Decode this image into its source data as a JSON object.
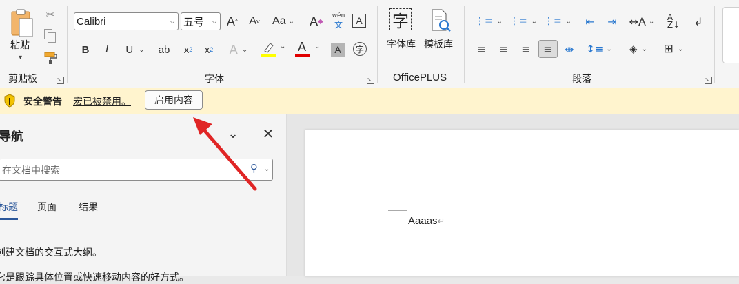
{
  "ribbon": {
    "clipboard": {
      "paste_label": "粘贴",
      "group_label": "剪贴板"
    },
    "font": {
      "font_name": "Calibri",
      "font_size": "五号",
      "group_label": "字体",
      "change_case_label": "Aa",
      "wen_top": "wén",
      "wen_bottom": "文",
      "char_border_label": "A",
      "superscript_mark": "2",
      "subscript_mark": "2",
      "highlight_color": "#ffff00",
      "font_color": "#e00000"
    },
    "officeplus": {
      "font_lib_label": "字体库",
      "template_lib_label": "模板库",
      "group_label": "OfficePLUS",
      "zi_glyph": "字"
    },
    "paragraph": {
      "group_label": "段落"
    }
  },
  "security_bar": {
    "title": "安全警告",
    "message": "宏已被禁用。",
    "button_label": "启用内容"
  },
  "nav_pane": {
    "title": "导航",
    "search_placeholder": "在文档中搜索",
    "tabs": [
      "标题",
      "页面",
      "结果"
    ],
    "active_tab": 0,
    "info_line1": "创建文档的交互式大纲。",
    "info_line2": "它是跟踪具体位置或快速移动内容的好方式。"
  },
  "document": {
    "body_text": "Aaaas"
  },
  "colors": {
    "accent": "#2b579a",
    "warning_bg": "#fff4ce",
    "arrow": "#e02525"
  }
}
